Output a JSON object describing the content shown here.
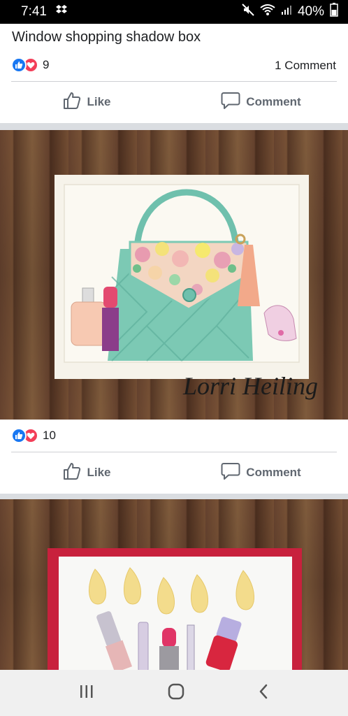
{
  "status_bar": {
    "time": "7:41",
    "battery": "40%",
    "icons": [
      "dropbox-icon",
      "mute-icon",
      "wifi-icon",
      "signal-icon",
      "battery-icon"
    ]
  },
  "post": {
    "title": "Window shopping shadow box",
    "reaction_count": "9",
    "comment_count": "1 Comment",
    "like_label": "Like",
    "comment_label": "Comment"
  },
  "photo_post": {
    "watermark": "Lorri Heiling",
    "reaction_count": "10",
    "like_label": "Like",
    "comment_label": "Comment"
  },
  "nav_bar": {
    "buttons": [
      "recent-apps",
      "home",
      "back"
    ]
  },
  "colors": {
    "like_blue": "#1877f2",
    "love_red": "#f33e58",
    "text_dark": "#1c1e21",
    "action_gray": "#606770",
    "separator": "#dadde1"
  }
}
